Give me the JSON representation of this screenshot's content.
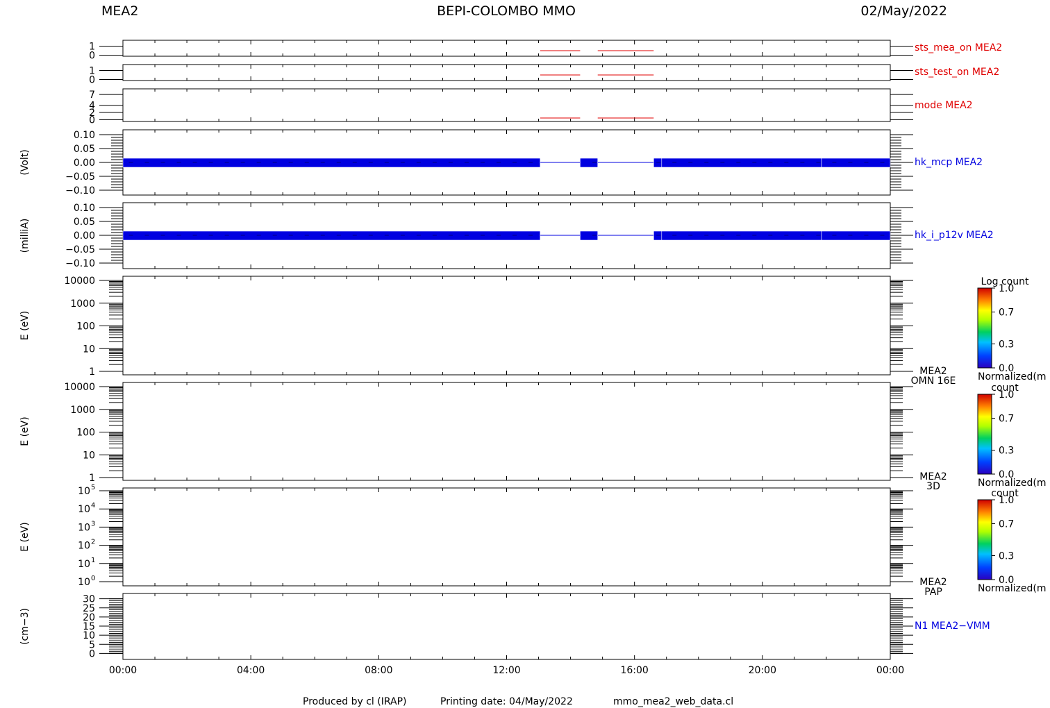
{
  "header": {
    "left": "MEA2",
    "center": "BEPI-COLOMBO MMO",
    "right": "02/May/2022"
  },
  "footer": {
    "produced_by": "Produced by cl (IRAP)",
    "printing_date": "Printing date: 04/May/2022",
    "script": "mmo_mea2_web_data.cl"
  },
  "colors": {
    "red": "#e00000",
    "blue": "#0000e0",
    "axis": "#000000"
  },
  "chart_data": [
    {
      "type": "line",
      "id": "sts_mea_on",
      "label": "sts_mea_on MEA2",
      "label_color": "red",
      "ylabel": "",
      "ylim": [
        -0.5,
        1.5
      ],
      "yticks": [
        "1",
        "0"
      ],
      "ytick_values": [
        1,
        0
      ],
      "x_unit": "hours",
      "segments": [
        {
          "x": [
            13.05,
            14.3
          ],
          "y": 0.5
        },
        {
          "x": [
            14.85,
            16.6
          ],
          "y": 0.5
        }
      ]
    },
    {
      "type": "line",
      "id": "sts_test_on",
      "label": "sts_test_on MEA2",
      "label_color": "red",
      "ylabel": "",
      "ylim": [
        -0.5,
        1.5
      ],
      "yticks": [
        "1",
        "0"
      ],
      "ytick_values": [
        1,
        0
      ],
      "x_unit": "hours",
      "segments": [
        {
          "x": [
            13.05,
            14.3
          ],
          "y": 0.5
        },
        {
          "x": [
            14.85,
            16.6
          ],
          "y": 0.5
        }
      ]
    },
    {
      "type": "line",
      "id": "mode",
      "label": "mode MEA2",
      "label_color": "red",
      "ylabel": "",
      "ylim": [
        -0.5,
        8
      ],
      "yticks": [
        "7",
        "4",
        "2",
        "0"
      ],
      "ytick_values": [
        7,
        4,
        2,
        0
      ],
      "x_unit": "hours",
      "segments": [
        {
          "x": [
            13.05,
            14.3
          ],
          "y": 0
        },
        {
          "x": [
            14.85,
            16.6
          ],
          "y": 0
        }
      ]
    },
    {
      "type": "bar",
      "id": "hk_mcp",
      "label": "hk_mcp MEA2",
      "label_color": "blue",
      "ylabel": "(Volt)",
      "ylim": [
        -0.12,
        0.12
      ],
      "yticks": [
        "0.10",
        "0.05",
        "0.00",
        "−0.05",
        "−0.10"
      ],
      "ytick_values": [
        0.1,
        0.05,
        0.0,
        -0.05,
        -0.1
      ],
      "x_unit": "hours",
      "value": 0.0,
      "blocks": [
        [
          0,
          13.05
        ],
        [
          14.3,
          14.85
        ],
        [
          16.6,
          16.85
        ],
        [
          16.85,
          21.85
        ],
        [
          21.85,
          24
        ]
      ],
      "thin_line": [
        0,
        24
      ]
    },
    {
      "type": "bar",
      "id": "hk_i_p12v",
      "label": "hk_i_p12v MEA2",
      "label_color": "blue",
      "ylabel": "(milliA)",
      "ylim": [
        -0.12,
        0.12
      ],
      "yticks": [
        "0.10",
        "0.05",
        "0.00",
        "−0.05",
        "−0.10"
      ],
      "ytick_values": [
        0.1,
        0.05,
        0.0,
        -0.05,
        -0.1
      ],
      "x_unit": "hours",
      "value": 0.0,
      "blocks": [
        [
          0,
          13.05
        ],
        [
          14.3,
          14.85
        ],
        [
          16.6,
          16.85
        ],
        [
          16.85,
          21.85
        ],
        [
          21.85,
          24
        ]
      ],
      "thin_line": [
        0,
        24
      ]
    },
    {
      "type": "heatmap",
      "id": "omn16e",
      "label_lines": [
        "MEA2",
        "OMN 16E"
      ],
      "ylabel": "E (eV)",
      "log_scale": true,
      "ylim": [
        1,
        10000
      ],
      "yticks": [
        "10000",
        "1000",
        "100",
        "10",
        "1"
      ],
      "ytick_values": [
        10000,
        1000,
        100,
        10,
        1
      ],
      "colorbar": {
        "title": "Log count",
        "footer": "Normalized(m",
        "ticks": [
          "1.0",
          "0.7",
          "0.3",
          "0.0"
        ],
        "tick_values": [
          1.0,
          0.7,
          0.3,
          0.0
        ]
      }
    },
    {
      "type": "heatmap",
      "id": "3d",
      "label_lines": [
        "MEA2",
        "3D"
      ],
      "ylabel": "E (eV)",
      "log_scale": true,
      "ylim": [
        1,
        10000
      ],
      "yticks": [
        "10000",
        "1000",
        "100",
        "10",
        "1"
      ],
      "ytick_values": [
        10000,
        1000,
        100,
        10,
        1
      ],
      "colorbar": {
        "title": "count",
        "footer": "Normalized(m",
        "ticks": [
          "1.0",
          "0.7",
          "0.3",
          "0.0"
        ],
        "tick_values": [
          1.0,
          0.7,
          0.3,
          0.0
        ]
      }
    },
    {
      "type": "heatmap",
      "id": "pap",
      "label_lines": [
        "MEA2",
        "PAP"
      ],
      "ylabel": "E (eV)",
      "log_scale": true,
      "ylim": [
        1,
        100000
      ],
      "yticks_pow": [
        "5",
        "4",
        "3",
        "2",
        "1",
        "0"
      ],
      "ytick_values": [
        100000,
        10000,
        1000,
        100,
        10,
        1
      ],
      "colorbar": {
        "title": "count",
        "footer": "Normalized(m",
        "ticks": [
          "1.0",
          "0.7",
          "0.3",
          "0.0"
        ],
        "tick_values": [
          1.0,
          0.7,
          0.3,
          0.0
        ]
      }
    },
    {
      "type": "line",
      "id": "n1",
      "label": "N1 MEA2−VMM",
      "label_color": "blue",
      "ylabel": "(cm−3)",
      "ylim": [
        -1,
        31
      ],
      "yticks": [
        "30",
        "25",
        "20",
        "15",
        "10",
        "5",
        "0"
      ],
      "ytick_values": [
        30,
        25,
        20,
        15,
        10,
        5,
        0
      ],
      "x_unit": "hours",
      "segments": []
    }
  ],
  "xaxis": {
    "ticks": [
      "00:00",
      "04:00",
      "08:00",
      "12:00",
      "16:00",
      "20:00",
      "00:00"
    ],
    "tick_hours": [
      0,
      4,
      8,
      12,
      16,
      20,
      24
    ],
    "range_hours": [
      0,
      24
    ]
  }
}
